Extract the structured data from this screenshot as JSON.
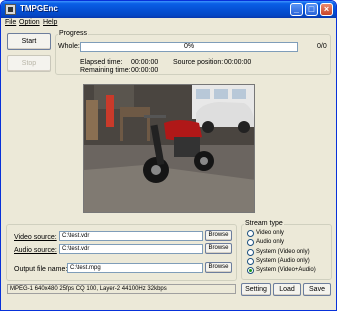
{
  "window": {
    "title": "TMPGEnc"
  },
  "titlebar": {
    "minimize_glyph": "_",
    "maximize_glyph": "□",
    "close_glyph": "×"
  },
  "menu": {
    "file": "File",
    "option": "Option",
    "help": "Help"
  },
  "controls": {
    "start_label": "Start",
    "stop_label": "Stop"
  },
  "progress": {
    "group_title": "Progress",
    "whole_label": "Whole:",
    "percent": "0%",
    "percent_value": 0,
    "count": "0/0",
    "elapsed_label": "Elapsed time:",
    "elapsed_value": "00:00:00",
    "remaining_label": "Remaining time:",
    "remaining_value": "00:00:00",
    "source_position_label": "Source position:",
    "source_position_value": "00:00:00"
  },
  "sources": {
    "video_label": "Video source:",
    "video_value": "C:\\test.vdr",
    "audio_label": "Audio source:",
    "audio_value": "C:\\test.vdr",
    "output_label": "Output file name:",
    "output_value": "C:\\test.mpg",
    "browse_label": "Browse"
  },
  "stream_type": {
    "group_title": "Stream type",
    "options": [
      "Video only",
      "Audio only",
      "System (Video only)",
      "System (Audio only)",
      "System (Video+Audio)"
    ],
    "selected": "System (Video+Audio)"
  },
  "footer": {
    "status": "MPEG-1 640x480 25fps CQ 100,  Layer-2 44100Hz 32kbps",
    "setting_label": "Setting",
    "load_label": "Load",
    "save_label": "Save"
  },
  "colors": {
    "titlebar": "#0551d6",
    "window_bg": "#ece9d8",
    "progress_fill": "#2ba63a"
  }
}
